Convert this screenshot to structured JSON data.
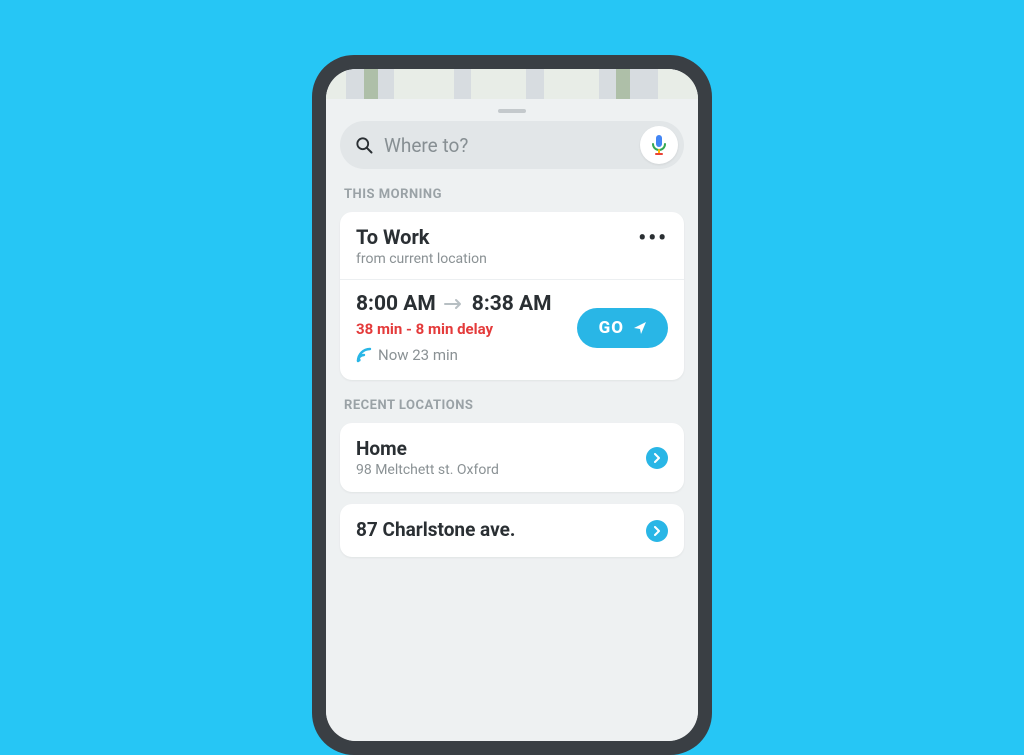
{
  "search": {
    "placeholder": "Where to?"
  },
  "sections": {
    "morning_label": "THIS MORNING",
    "recent_label": "RECENT LOCATIONS"
  },
  "trip": {
    "title": "To Work",
    "from": "from current location",
    "depart_time": "8:00 AM",
    "arrive_time": "8:38 AM",
    "delay_line": "38 min -  8 min delay",
    "now_line": "Now 23 min",
    "go_label": "GO"
  },
  "recent": [
    {
      "title": "Home",
      "address": "98 Meltchett st. Oxford"
    },
    {
      "title": "87 Charlstone ave.",
      "address": ""
    }
  ],
  "colors": {
    "background": "#26c6f5",
    "accent": "#29b6e6",
    "delay": "#e43b3b"
  }
}
